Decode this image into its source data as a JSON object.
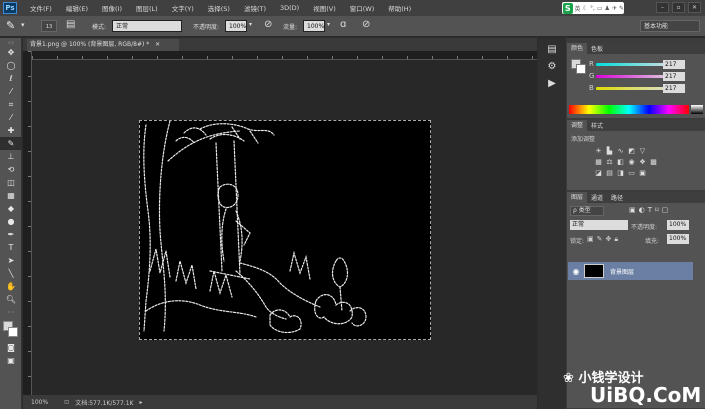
{
  "app": {
    "logo": "Ps"
  },
  "menu": [
    "文件(F)",
    "编辑(E)",
    "图像(I)",
    "图层(L)",
    "文字(Y)",
    "选择(S)",
    "滤镜(T)",
    "3D(D)",
    "视图(V)",
    "窗口(W)",
    "帮助(H)"
  ],
  "ime": {
    "logo": "S",
    "mode": "英"
  },
  "options": {
    "brush_size": "13",
    "mode_label": "模式:",
    "mode_value": "正常",
    "opacity_label": "不透明度:",
    "opacity_value": "100%",
    "flow_label": "流量:",
    "flow_value": "100%",
    "workspace": "基本功能"
  },
  "document": {
    "tab": "背景1.png @ 100% (背景图层, RGB/8#) *",
    "zoom": "100%",
    "status": "文档:577.1K/577.1K"
  },
  "color_panel": {
    "tabs": [
      "颜色",
      "色板"
    ],
    "channels": [
      {
        "name": "R",
        "value": "217",
        "color": "#c06070"
      },
      {
        "name": "G",
        "value": "217",
        "color": "#6da070"
      },
      {
        "name": "B",
        "value": "217",
        "color": "#6060c0"
      }
    ]
  },
  "adjust_panel": {
    "tabs": [
      "调整",
      "样式"
    ],
    "title": "添加调整"
  },
  "layers_panel": {
    "tabs": [
      "图层",
      "通道",
      "路径"
    ],
    "kind": "类型",
    "blend": "正常",
    "opacity_label": "不透明度:",
    "opacity_value": "100%",
    "lock_label": "锁定:",
    "fill_label": "填充:",
    "fill_value": "100%",
    "layer_name": "背景图层"
  },
  "watermark": {
    "line1": "小钱学设计",
    "line2": "UiBQ.CoM"
  }
}
